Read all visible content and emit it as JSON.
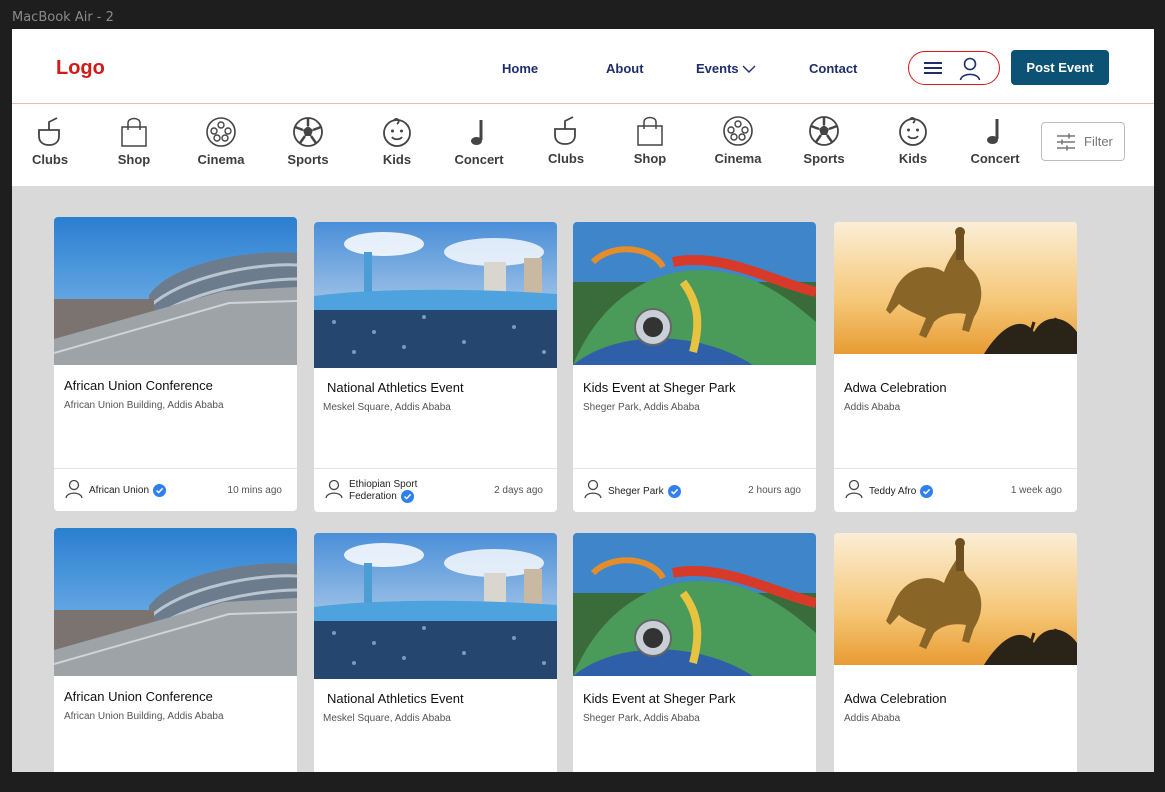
{
  "frame": {
    "label": "MacBook Air - 2"
  },
  "header": {
    "logo": "Logo",
    "nav": [
      {
        "label": "Home"
      },
      {
        "label": "About"
      },
      {
        "label": "Events"
      },
      {
        "label": "Contact"
      }
    ],
    "post_event_label": "Post Event"
  },
  "categories": [
    {
      "label": "Clubs",
      "icon": "drink-icon"
    },
    {
      "label": "Shop",
      "icon": "shopping-bag-icon"
    },
    {
      "label": "Cinema",
      "icon": "film-reel-icon"
    },
    {
      "label": "Sports",
      "icon": "soccer-ball-icon"
    },
    {
      "label": "Kids",
      "icon": "baby-face-icon"
    },
    {
      "label": "Concert",
      "icon": "music-note-icon"
    },
    {
      "label": "Clubs",
      "icon": "drink-icon"
    },
    {
      "label": "Shop",
      "icon": "shopping-bag-icon"
    },
    {
      "label": "Cinema",
      "icon": "film-reel-icon"
    },
    {
      "label": "Sports",
      "icon": "soccer-ball-icon"
    },
    {
      "label": "Kids",
      "icon": "baby-face-icon"
    },
    {
      "label": "Concert",
      "icon": "music-note-icon"
    }
  ],
  "filter_label": "Filter",
  "events": [
    {
      "title": "African Union Conference",
      "location": "African Union Building, Addis Ababa",
      "organizer": "African Union",
      "organizer_line2": "",
      "time": "10 mins ago"
    },
    {
      "title": "National Athletics Event",
      "location": "Meskel Square, Addis Ababa",
      "organizer": "Ethiopian Sport",
      "organizer_line2": "Federation",
      "time": "2 days ago"
    },
    {
      "title": "Kids Event at Sheger Park",
      "location": "Sheger Park, Addis Ababa",
      "organizer": "Sheger Park",
      "organizer_line2": "",
      "time": "2 hours ago"
    },
    {
      "title": "Adwa Celebration",
      "location": "Addis Ababa",
      "organizer": "Teddy Afro",
      "organizer_line2": "",
      "time": "1 week ago"
    },
    {
      "title": "African Union Conference",
      "location": "African Union Building, Addis Ababa"
    },
    {
      "title": "National Athletics Event",
      "location": "Meskel Square, Addis Ababa"
    },
    {
      "title": "Kids Event at Sheger Park",
      "location": "Sheger Park, Addis Ababa"
    },
    {
      "title": "Adwa Celebration",
      "location": "Addis Ababa"
    }
  ],
  "colors": {
    "brand_red": "#d11a1a",
    "nav_text": "#1f2d6b",
    "primary_button": "#0b5275",
    "verified_blue": "#2f80ed"
  }
}
